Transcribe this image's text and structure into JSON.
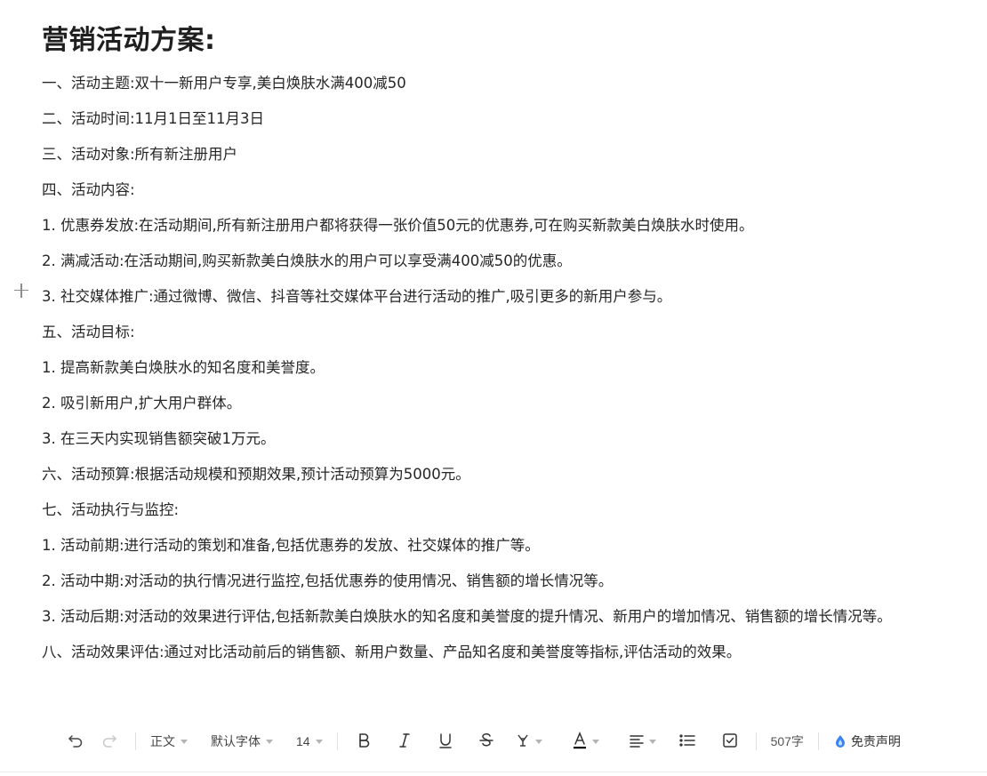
{
  "document": {
    "title": "营销活动方案:",
    "paragraphs": [
      "一、活动主题:双十一新用户专享,美白焕肤水满400减50",
      "二、活动时间:11月1日至11月3日",
      "三、活动对象:所有新注册用户",
      "四、活动内容:",
      "1. 优惠券发放:在活动期间,所有新注册用户都将获得一张价值50元的优惠券,可在购买新款美白焕肤水时使用。",
      "2. 满减活动:在活动期间,购买新款美白焕肤水的用户可以享受满400减50的优惠。",
      "3. 社交媒体推广:通过微博、微信、抖音等社交媒体平台进行活动的推广,吸引更多的新用户参与。",
      "五、活动目标:",
      "1. 提高新款美白焕肤水的知名度和美誉度。",
      "2. 吸引新用户,扩大用户群体。",
      "3. 在三天内实现销售额突破1万元。",
      "六、活动预算:根据活动规模和预期效果,预计活动预算为5000元。",
      "七、活动执行与监控:",
      "1. 活动前期:进行活动的策划和准备,包括优惠券的发放、社交媒体的推广等。",
      "2. 活动中期:对活动的执行情况进行监控,包括优惠券的使用情况、销售额的增长情况等。",
      "3. 活动后期:对活动的效果进行评估,包括新款美白焕肤水的知名度和美誉度的提升情况、新用户的增加情况、销售额的增长情况等。",
      "八、活动效果评估:通过对比活动前后的销售额、新用户数量、产品知名度和美誉度等指标,评估活动的效果。"
    ]
  },
  "toolbar": {
    "style_label": "正文",
    "font_label": "默认字体",
    "size_label": "14",
    "word_count": "507字",
    "disclaimer_label": "免责声明",
    "icons": [
      "undo-icon",
      "redo-icon",
      "bold-icon",
      "italic-icon",
      "underline-icon",
      "strikethrough-icon",
      "highlight-icon",
      "font-color-icon",
      "align-icon",
      "list-icon",
      "checkbox-icon",
      "disclaimer-icon"
    ],
    "font_color_underline": "#000000"
  }
}
